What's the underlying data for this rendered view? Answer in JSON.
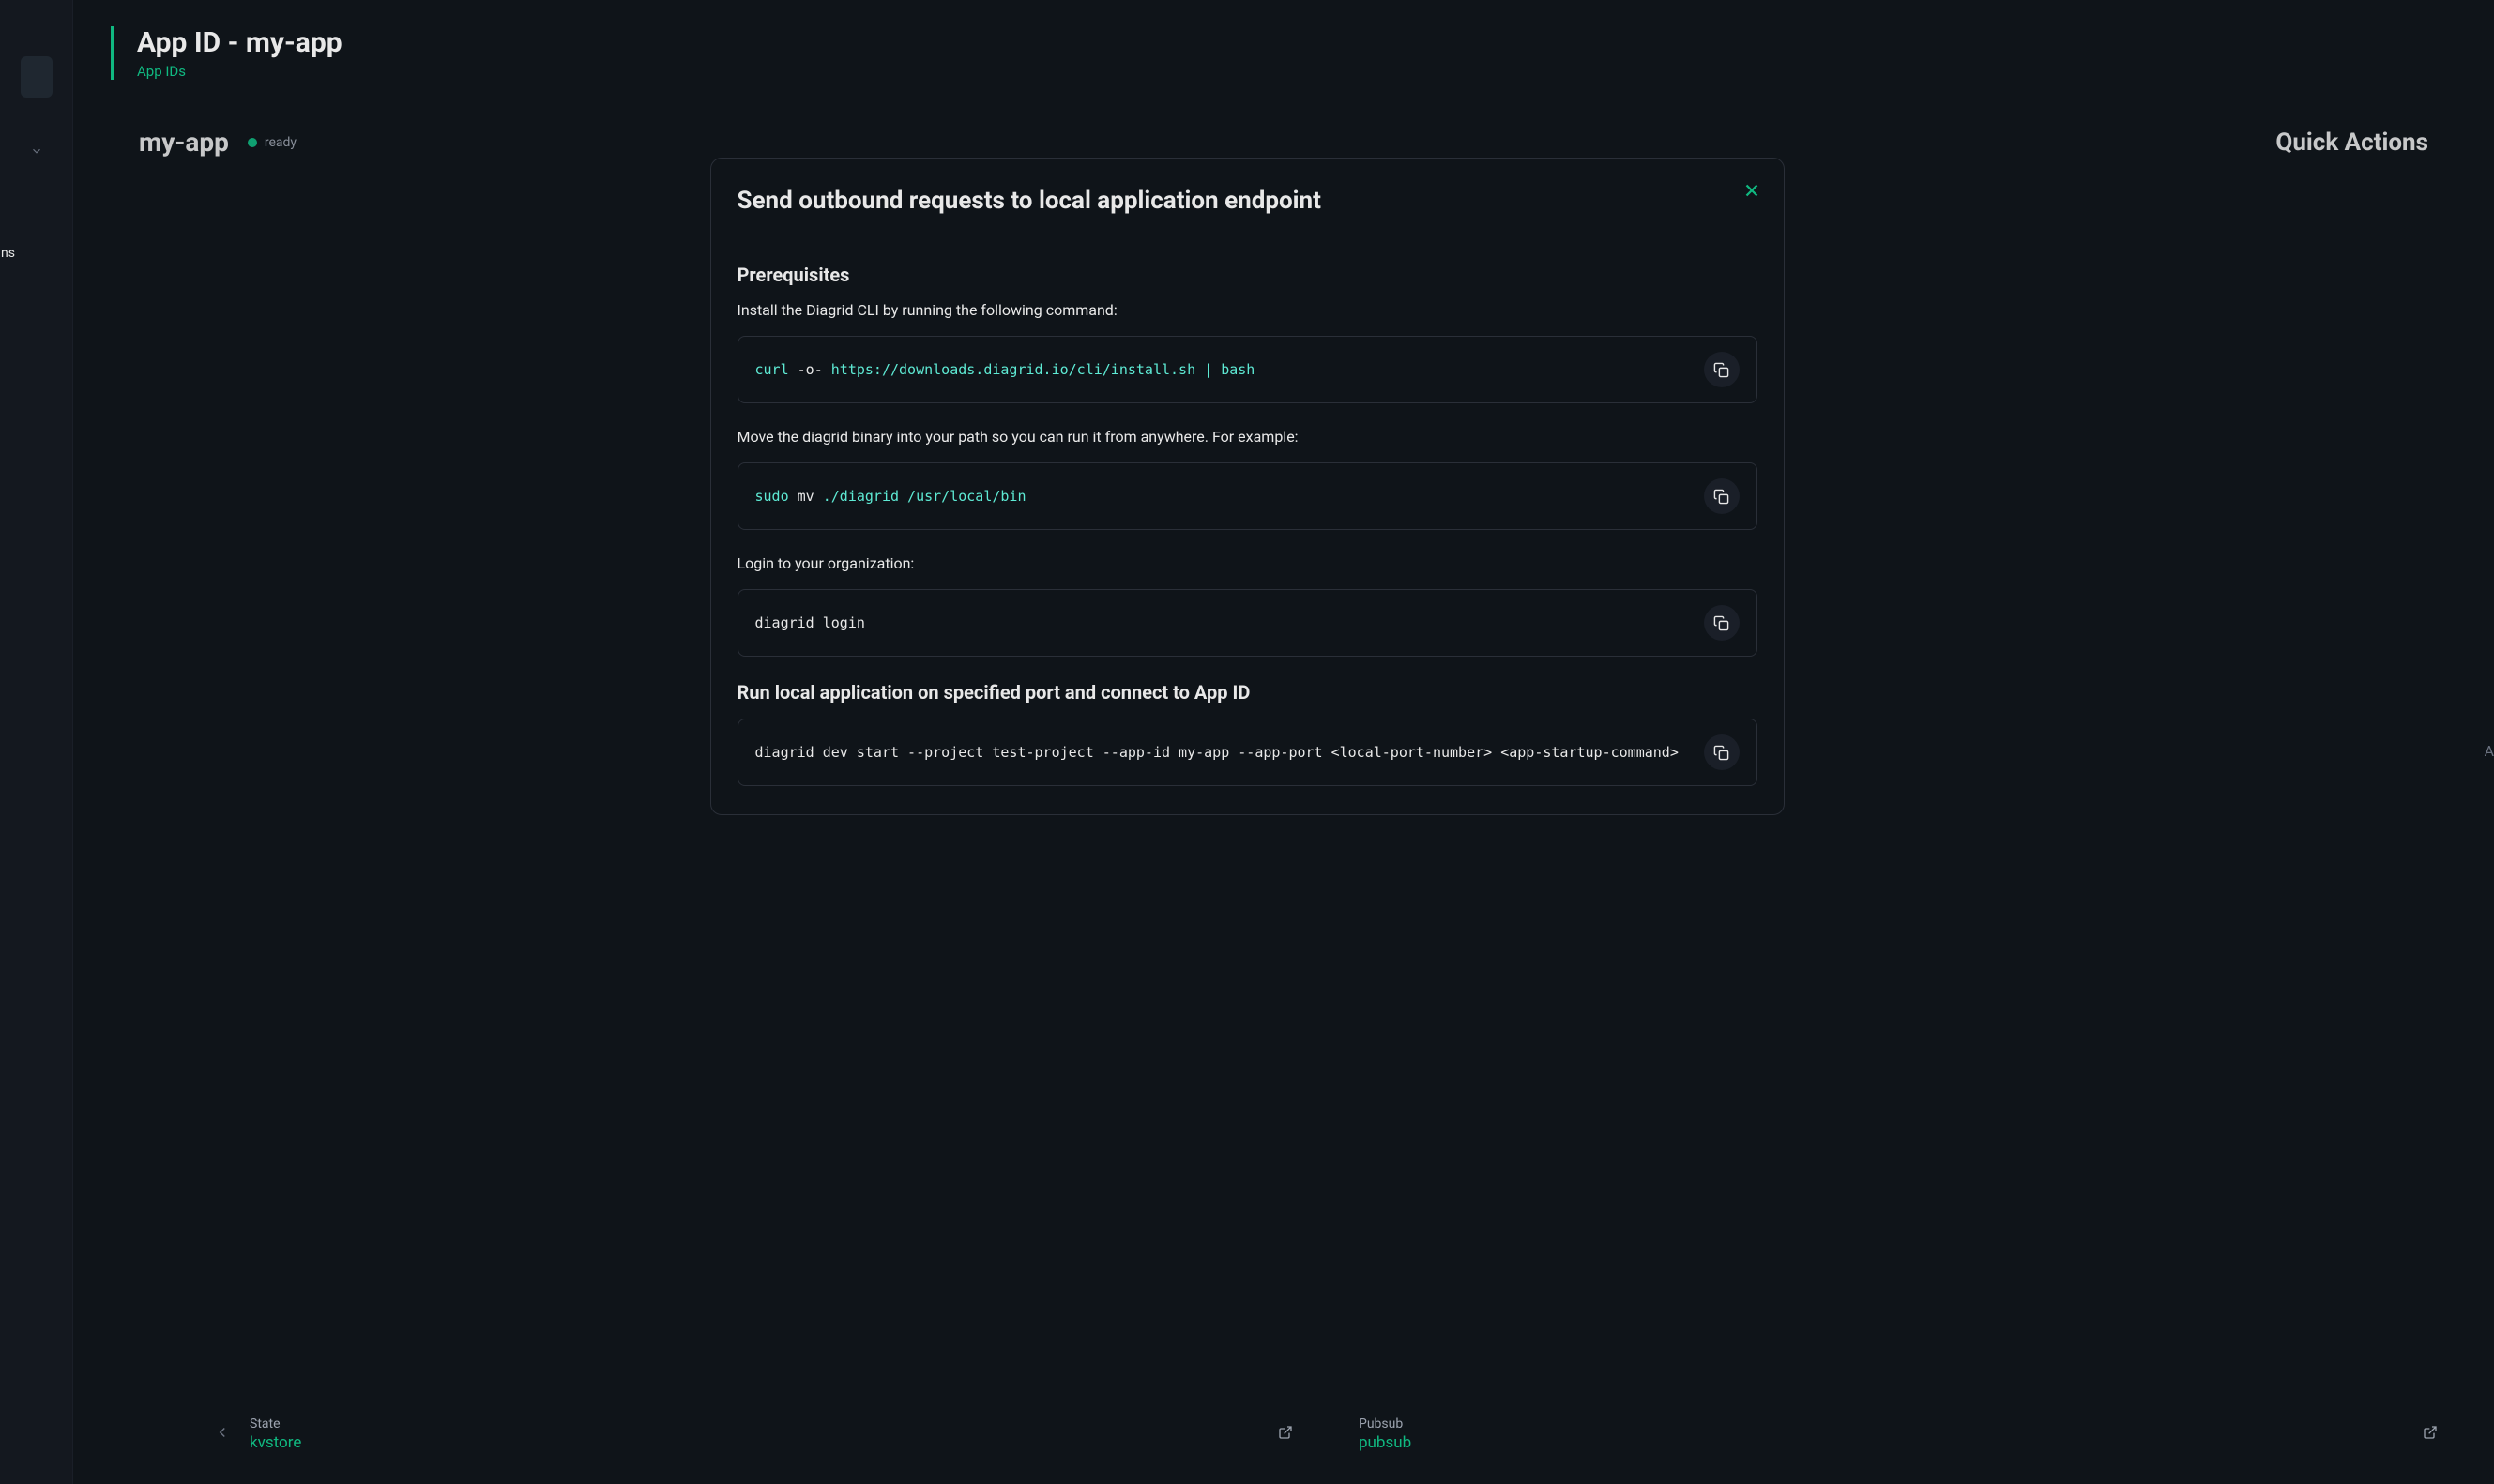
{
  "page": {
    "title": "App ID - my-app",
    "breadcrumb": "App IDs"
  },
  "background": {
    "appName": "my-app",
    "statusLabel": "ready",
    "quickActionsTitle": "Quick Actions",
    "panels": [
      {
        "label": "State",
        "value": "kvstore"
      },
      {
        "label": "Pubsub",
        "value": "pubsub"
      }
    ],
    "rightEdgeText": "A"
  },
  "sidebar": {
    "truncatedLabel": "ns"
  },
  "modal": {
    "title": "Send outbound requests to local application endpoint",
    "prerequisites": {
      "heading": "Prerequisites",
      "installDesc": "Install the Diagrid CLI by running the following command:",
      "installCmd": {
        "p1": "curl",
        "p2": " -o- ",
        "p3": "https://downloads.diagrid.io/cli/install.sh | bash"
      },
      "moveDesc": "Move the diagrid binary into your path so you can run it from anywhere. For example:",
      "moveCmd": {
        "p1": "sudo",
        "p2": " mv ",
        "p3": "./diagrid /usr/local/bin"
      },
      "loginDesc": "Login to your organization:",
      "loginCmd": "diagrid login"
    },
    "run": {
      "heading": "Run local application on specified port and connect to App ID",
      "cmd": "diagrid dev start --project test-project --app-id my-app --app-port <local-port-number> <app-startup-command>"
    }
  }
}
